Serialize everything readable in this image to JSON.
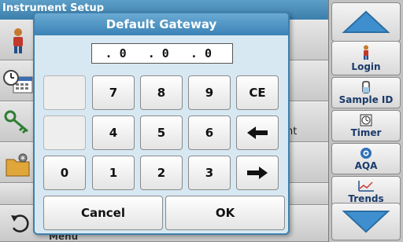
{
  "background": {
    "title": "Instrument Setup",
    "partial_row_text": "nt",
    "menu_label": "Menu"
  },
  "sidebar": {
    "items": [
      {
        "label": "Login",
        "icon": "person-icon"
      },
      {
        "label": "Sample ID",
        "icon": "vial-icon"
      },
      {
        "label": "Timer",
        "icon": "timer-icon"
      },
      {
        "label": "AQA",
        "icon": "aqa-icon"
      },
      {
        "label": "Trends",
        "icon": "trend-chart-icon"
      }
    ],
    "scroll_up": "up-arrow-icon",
    "scroll_down": "down-arrow-icon"
  },
  "dialog": {
    "title": "Default Gateway",
    "ip_value": ". 0   . 0   . 0",
    "keys": {
      "k7": "7",
      "k8": "8",
      "k9": "9",
      "ce": "CE",
      "k4": "4",
      "k5": "5",
      "k6": "6",
      "k0": "0",
      "k1": "1",
      "k2": "2",
      "k3": "3"
    },
    "cancel_label": "Cancel",
    "ok_label": "OK"
  },
  "colors": {
    "title_bar": "#3b83b6",
    "dialog_bg": "#d7e8f3",
    "sidebar_label": "#1a3a6a",
    "arrow_fill": "#3f8fce"
  }
}
